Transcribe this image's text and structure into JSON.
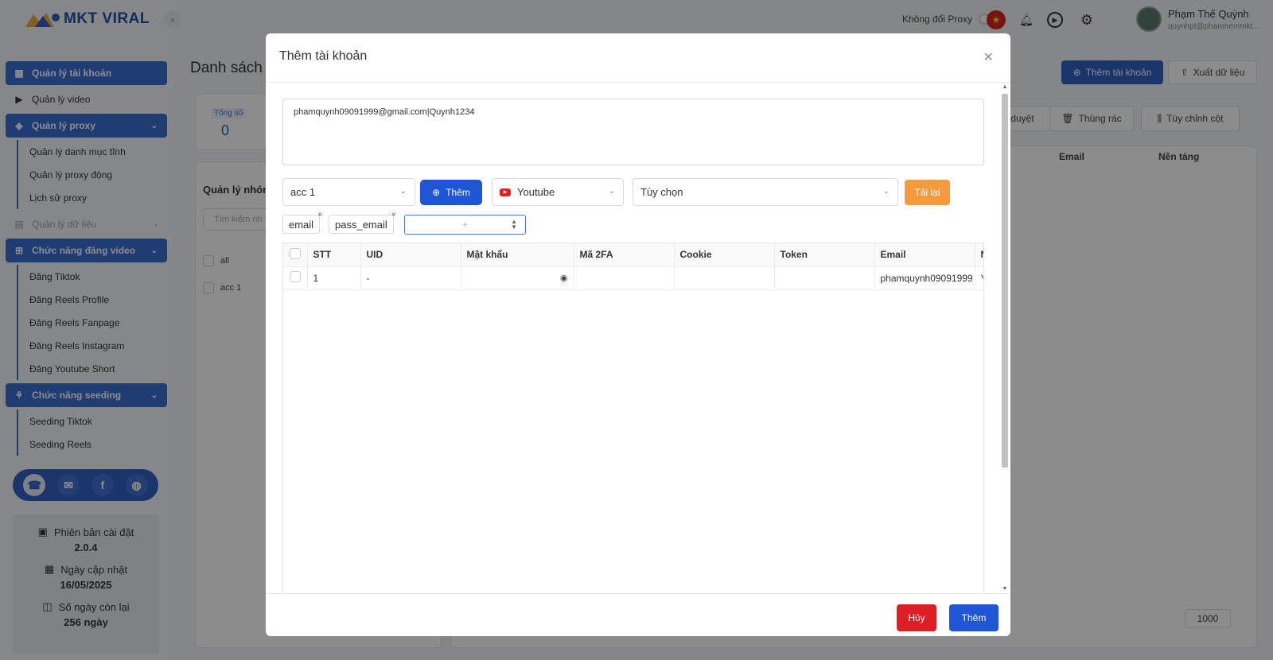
{
  "app": {
    "brand": "MKT VIRAL",
    "collapse_icon": "chevron-left-icon"
  },
  "sidebar": {
    "menu": [
      {
        "label": "Quản lý tài khoản",
        "active": true
      },
      {
        "label": "Quản lý video",
        "active": false
      },
      {
        "label": "Quản lý proxy",
        "active": true
      },
      {
        "label": "Quản lý dữ liệu",
        "active": false
      },
      {
        "label": "Chức năng đăng video",
        "active": true
      },
      {
        "label": "Chức năng seeding",
        "active": true
      }
    ],
    "proxy_sub": [
      "Quản lý danh mục tĩnh",
      "Quản lý proxy động",
      "Lịch sử proxy"
    ],
    "video_sub": [
      "Đăng Tiktok",
      "Đăng Reels Profile",
      "Đăng Reels Fanpage",
      "Đăng Reels Instagram",
      "Đăng Youtube Short"
    ],
    "seeding_sub": [
      "Seeding Tiktok",
      "Seeding Reels"
    ],
    "info": {
      "version_label": "Phiên bản cài đặt",
      "version": "2.0.4",
      "updated_label": "Ngày cập nhật",
      "updated": "16/05/2025",
      "days_label": "Số ngày còn lại",
      "days": "256 ngày"
    }
  },
  "topbar": {
    "proxy_label": "Không đổi Proxy",
    "user_name": "Phạm Thế Quỳnh",
    "user_email": "quynhpt@phanmemmkt..."
  },
  "main": {
    "page_title": "Danh sách",
    "total_label": "Tổng số",
    "total_value": "0",
    "group_title": "Quản lý nhón",
    "group_search_placeholder": "Tìm kiếm nh",
    "groups": [
      "all",
      "acc 1"
    ],
    "add_account_button": "Thêm tài khoản",
    "export_button": "Xuất dữ liệu",
    "approve_chip": "duyệt",
    "trash_chip": "Thùng rác",
    "columns_chip": "Tùy chỉnh cột",
    "bg_columns": [
      "Email",
      "Nền tảng"
    ],
    "page_size": "1000"
  },
  "modal": {
    "title": "Thêm tài khoản",
    "account_text": "phamquynh09091999@gmail.com|Quynh1234",
    "group_select": "acc 1",
    "add_button": "Thêm",
    "platform_select": "Youtube",
    "option_select": "Tùy chọn",
    "reload_button": "Tải lại",
    "tags": [
      "email",
      "pass_email"
    ],
    "number_placeholder": "+",
    "table": {
      "columns": [
        "STT",
        "UID",
        "Mật khẩu",
        "Mã 2FA",
        "Cookie",
        "Token",
        "Email",
        "N"
      ],
      "rows": [
        {
          "stt": "1",
          "uid": "-",
          "password": "",
          "twofa": "",
          "cookie": "",
          "token": "",
          "email": "phamquynh09091999",
          "platform": "Yo"
        }
      ]
    },
    "cancel_button": "Hủy",
    "submit_button": "Thêm"
  },
  "colors": {
    "primary": "#1f56d6",
    "danger": "#dc1f26",
    "warning": "#f59b3d",
    "sidebar_active": "#3a6fd1"
  }
}
